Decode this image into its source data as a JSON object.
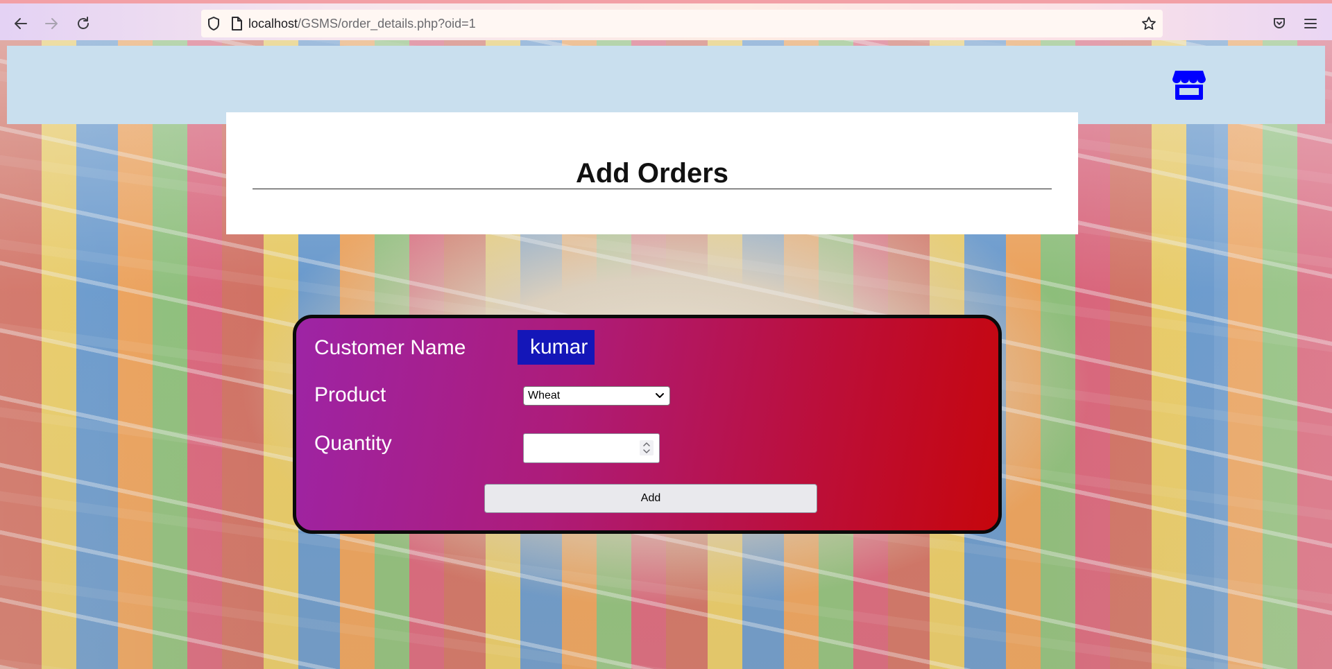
{
  "browser": {
    "url_host": "localhost",
    "url_path": "/GSMS/order_details.php?oid=1",
    "icons": [
      "back-arrow-icon",
      "forward-arrow-icon",
      "reload-icon",
      "shield-icon",
      "page-icon",
      "star-icon",
      "pocket-icon",
      "menu-icon"
    ]
  },
  "header": {
    "icon": "store-icon",
    "icon_color": "#0000ff",
    "band_color": "#c9dfee"
  },
  "title": {
    "text": "Add Orders"
  },
  "form": {
    "customer_label": "Customer Name",
    "customer_value": "kumar",
    "product_label": "Product",
    "product_selected": "Wheat",
    "quantity_label": "Quantity",
    "quantity_value": "",
    "add_label": "Add",
    "panel_gradient": [
      "#9d24a5",
      "#c6060c"
    ],
    "chip_color": "#1416b8"
  }
}
